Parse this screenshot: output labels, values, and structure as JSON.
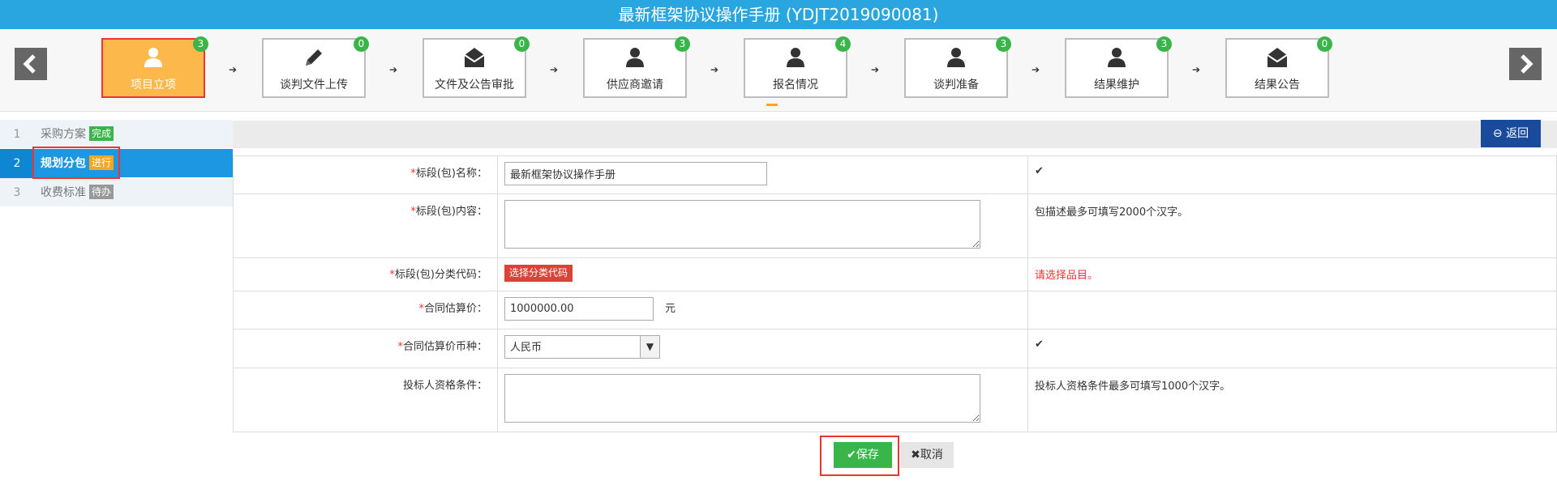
{
  "title": "最新框架协议操作手册 (YDJT2019090081)",
  "steps": [
    {
      "label": "项目立项",
      "badge": "3",
      "icon": "user-icon"
    },
    {
      "label": "谈判文件上传",
      "badge": "0",
      "icon": "pencil-icon"
    },
    {
      "label": "文件及公告审批",
      "badge": "0",
      "icon": "envelope-icon"
    },
    {
      "label": "供应商邀请",
      "badge": "3",
      "icon": "user-icon"
    },
    {
      "label": "报名情况",
      "badge": "4",
      "icon": "user-icon"
    },
    {
      "label": "谈判准备",
      "badge": "3",
      "icon": "user-icon"
    },
    {
      "label": "结果维护",
      "badge": "3",
      "icon": "user-icon"
    },
    {
      "label": "结果公告",
      "badge": "0",
      "icon": "envelope-icon"
    }
  ],
  "sidebar": {
    "items": [
      {
        "num": "1",
        "label": "采购方案",
        "tag": "完成"
      },
      {
        "num": "2",
        "label": "规划分包",
        "tag": "进行"
      },
      {
        "num": "3",
        "label": "收费标准",
        "tag": "待办"
      }
    ]
  },
  "toolbar": {
    "back_label": "返回"
  },
  "form": {
    "name_label": "标段(包)名称：",
    "name_value": "最新框架协议操作手册",
    "content_label": "标段(包)内容：",
    "content_hint": "包描述最多可填写2000个汉字。",
    "code_label": "标段(包)分类代码：",
    "code_button": "选择分类代码",
    "code_error": "请选择品目。",
    "price_label": "合同估算价：",
    "price_value": "1000000.00",
    "price_unit": "元",
    "currency_label": "合同估算价币种：",
    "currency_value": "人民币",
    "qual_label": "投标人资格条件：",
    "qual_hint": "投标人资格条件最多可填写1000个汉字。",
    "check_mark": "✔"
  },
  "actions": {
    "save_label": "保存",
    "cancel_label": "取消"
  }
}
